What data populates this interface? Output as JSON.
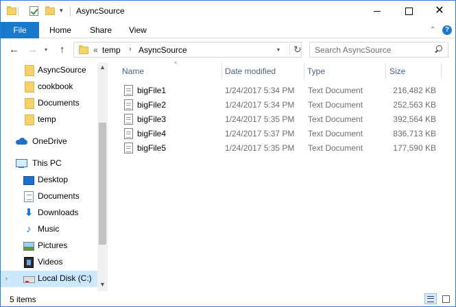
{
  "window": {
    "title": "AsyncSource",
    "close_glyph": "✕"
  },
  "quick_access": {
    "dropdown_glyph": "▾"
  },
  "ribbon": {
    "tabs": [
      "File",
      "Home",
      "Share",
      "View"
    ],
    "collapse_glyph": "⌃",
    "help_glyph": "?"
  },
  "nav_buttons": {
    "back": "←",
    "forward": "→",
    "recent": "▾",
    "up": "↑"
  },
  "address": {
    "overflow": "«",
    "parts": [
      "temp",
      "AsyncSource"
    ],
    "separator": "›",
    "dropdown_glyph": "▾",
    "refresh_glyph": "↻"
  },
  "search": {
    "placeholder": "Search AsyncSource"
  },
  "sidebar": {
    "quick_access": [
      "AsyncSource",
      "cookbook",
      "Documents",
      "temp"
    ],
    "onedrive": "OneDrive",
    "this_pc": "This PC",
    "this_pc_children": [
      "Desktop",
      "Documents",
      "Downloads",
      "Music",
      "Pictures",
      "Videos",
      "Local Disk (C:)"
    ],
    "expand_glyph": "›",
    "download_glyph": "⬇",
    "music_glyph": "♪"
  },
  "scrollbar": {
    "up": "▲",
    "down": "▼"
  },
  "file_list": {
    "sort_indicator": "^",
    "columns": [
      "Name",
      "Date modified",
      "Type",
      "Size"
    ],
    "rows": [
      {
        "name": "bigFile1",
        "date": "1/24/2017 5:34 PM",
        "type": "Text Document",
        "size": "216,482 KB"
      },
      {
        "name": "bigFile2",
        "date": "1/24/2017 5:34 PM",
        "type": "Text Document",
        "size": "252,563 KB"
      },
      {
        "name": "bigFile3",
        "date": "1/24/2017 5:35 PM",
        "type": "Text Document",
        "size": "392,564 KB"
      },
      {
        "name": "bigFile4",
        "date": "1/24/2017 5:37 PM",
        "type": "Text Document",
        "size": "836,713 KB"
      },
      {
        "name": "bigFile5",
        "date": "1/24/2017 5:35 PM",
        "type": "Text Document",
        "size": "177,590 KB"
      }
    ]
  },
  "status": {
    "item_count": "5 items"
  },
  "colors": {
    "accent": "#1979ca",
    "selection": "#cce8ff",
    "folder": "#f5d169"
  }
}
